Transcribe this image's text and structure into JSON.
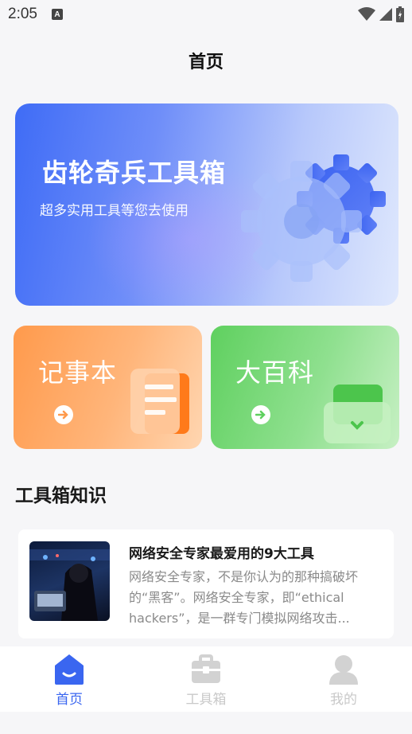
{
  "status_bar": {
    "time": "2:05",
    "a_icon_text": "A"
  },
  "header": {
    "title": "首页"
  },
  "banner": {
    "title": "齿轮奇兵工具箱",
    "subtitle": "超多实用工具等您去使用"
  },
  "cards": [
    {
      "title": "记事本"
    },
    {
      "title": "大百科"
    }
  ],
  "section": {
    "title": "工具箱知识"
  },
  "article": {
    "title": "网络安全专家最爱用的9大工具",
    "body": "网络安全专家，不是你认为的那种搞破坏的“黑客”。网络安全专家，即“ethical hackers”，是一群专门模拟网络攻击..."
  },
  "tabs": [
    {
      "label": "首页",
      "active": true
    },
    {
      "label": "工具箱",
      "active": false
    },
    {
      "label": "我的",
      "active": false
    }
  ],
  "colors": {
    "accent": "#3a66f0",
    "orange": "#ff9a4c",
    "green": "#5fd05f"
  }
}
